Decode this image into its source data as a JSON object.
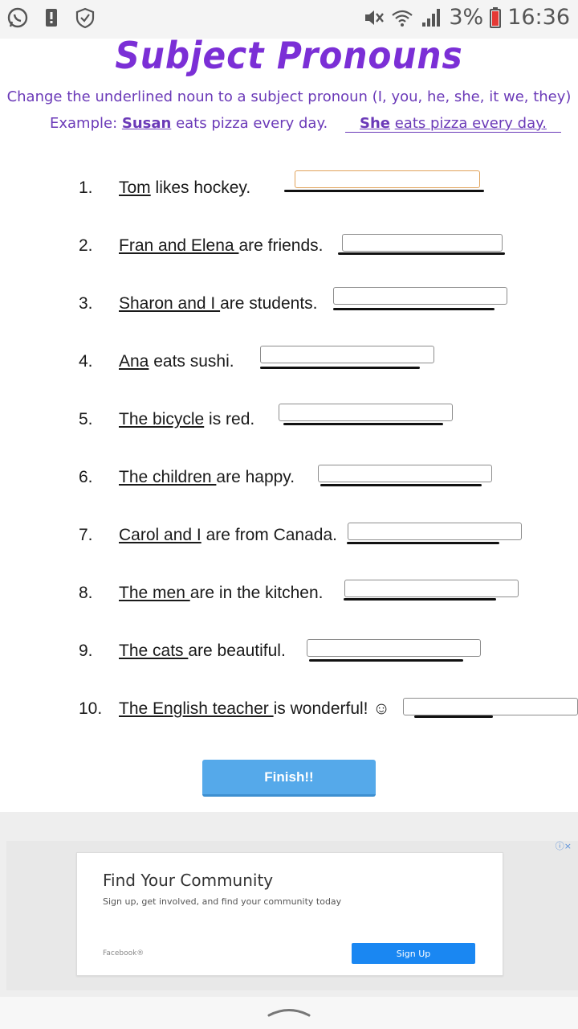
{
  "status_bar": {
    "left_icons": [
      "whatsapp-icon",
      "alert-icon",
      "shield-check-icon"
    ],
    "right_icons": [
      "mute-icon",
      "wifi-icon",
      "signal-icon"
    ],
    "battery_percent": "3%",
    "time": "16:36"
  },
  "worksheet": {
    "title": "Subject Pronouns",
    "instruction": "Change the underlined noun to a subject pronoun (I, you, he, she, it we, they)",
    "example": {
      "prefix": "Example:",
      "subject": "Susan",
      "rest": "eats pizza every day.",
      "answer_pronoun": "She",
      "answer_rest": "eats pizza every day."
    },
    "questions": [
      {
        "num": "1.",
        "underlined": "Tom",
        "rest": " likes hockey.",
        "value": ""
      },
      {
        "num": "2.",
        "underlined": "Fran and Elena ",
        "rest": "are friends.",
        "value": ""
      },
      {
        "num": "3.",
        "underlined": "Sharon and I ",
        "rest": "are students.",
        "value": ""
      },
      {
        "num": "4.",
        "underlined": "Ana",
        "rest": " eats sushi.",
        "value": ""
      },
      {
        "num": "5.",
        "underlined": "The bicycle",
        "rest": " is red.",
        "value": ""
      },
      {
        "num": "6.",
        "underlined": "The children ",
        "rest": "are happy.",
        "value": ""
      },
      {
        "num": "7.",
        "underlined": "Carol and I",
        "rest": " are from Canada.",
        "value": ""
      },
      {
        "num": "8.",
        "underlined": "The men ",
        "rest": "are in the kitchen.",
        "value": ""
      },
      {
        "num": "9.",
        "underlined": "The cats ",
        "rest": "are beautiful.",
        "value": ""
      },
      {
        "num": "10.",
        "underlined": "The English teacher ",
        "rest": "is wonderful! ☺",
        "value": ""
      }
    ],
    "finish_label": "Finish!!"
  },
  "ad": {
    "title": "Find Your Community",
    "subtitle": "Sign up, get involved, and find your community today",
    "brand": "Facebook®",
    "cta": "Sign Up",
    "close_icons": "ⓘ×"
  },
  "nav": {
    "icon": "chevron-up-icon"
  },
  "colors": {
    "title": "#7b2fd6",
    "instruction": "#6b3ab8",
    "finish_button": "#55a9ea",
    "ad_button": "#1a87f2"
  }
}
